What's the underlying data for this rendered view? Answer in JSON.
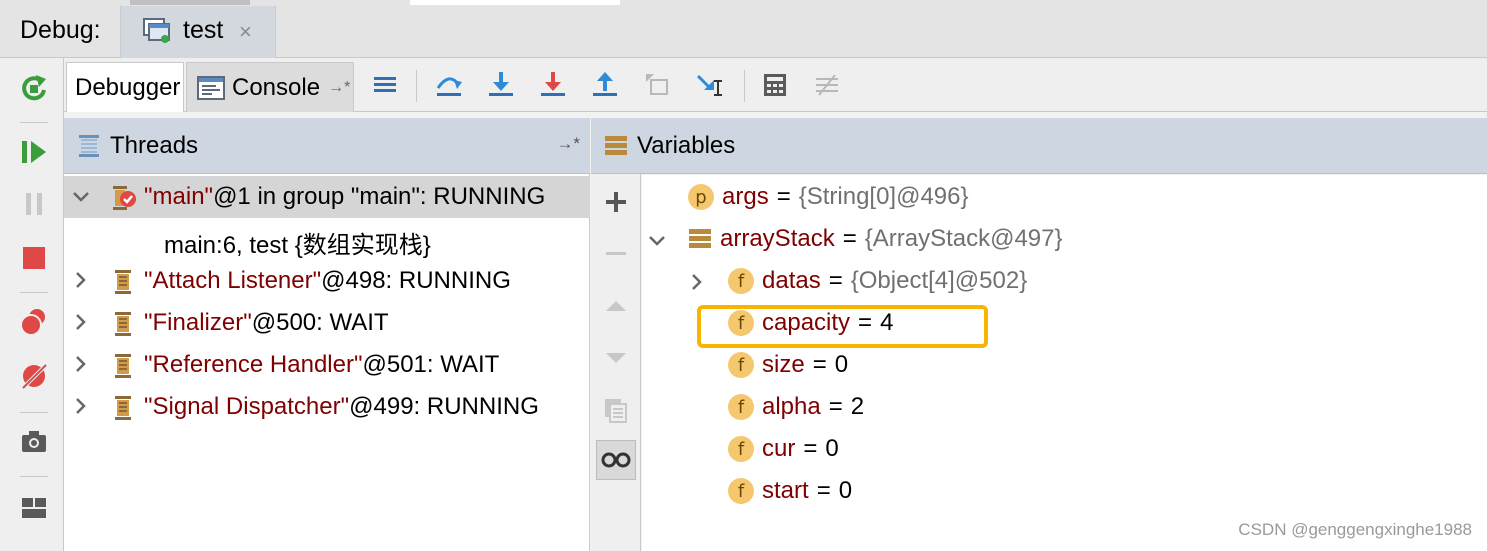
{
  "debug_window": {
    "label": "Debug:",
    "tab_title": "test",
    "tab_close_glyph": "×"
  },
  "toolbar": {
    "debugger_tab": "Debugger",
    "console_tab": "Console",
    "console_pin_glyph": "→*",
    "icons": [
      "show-execution-point-icon",
      "step-over-icon",
      "step-into-icon",
      "force-step-into-icon",
      "step-out-icon",
      "drop-frame-icon",
      "run-to-cursor-icon",
      "evaluate-expression-icon",
      "trace-icon"
    ]
  },
  "left_actions": [
    "rerun-icon",
    "resume-icon",
    "pause-icon",
    "stop-icon",
    "view-breakpoints-icon",
    "mute-breakpoints-icon",
    "camera-icon",
    "layout-icon"
  ],
  "threads": {
    "title": "Threads",
    "pin_glyph": "→*",
    "items": [
      {
        "quoted": "\"main\"",
        "rest": "@1 in group \"main\": RUNNING",
        "expanded": true,
        "selected": true
      },
      {
        "quoted": "\"Attach Listener\"",
        "rest": "@498: RUNNING",
        "expanded": false
      },
      {
        "quoted": "\"Finalizer\"",
        "rest": "@500: WAIT",
        "expanded": false
      },
      {
        "quoted": "\"Reference Handler\"",
        "rest": "@501: WAIT",
        "expanded": false
      },
      {
        "quoted": "\"Signal Dispatcher\"",
        "rest": "@499: RUNNING",
        "expanded": false
      }
    ],
    "frame": "main:6, test {数组实现栈}"
  },
  "variables": {
    "title": "Variables",
    "side_buttons": [
      "add-icon",
      "remove-icon",
      "move-up-icon",
      "move-down-icon",
      "copy-icon",
      "watches-icon"
    ],
    "rows": [
      {
        "badge": "p",
        "name": "args",
        "eq": "=",
        "value": "{String[0]@496}",
        "object": true
      },
      {
        "badge": "",
        "name": "arrayStack",
        "eq": "=",
        "value": "{ArrayStack@497}",
        "object": true
      },
      {
        "badge": "f",
        "name": "datas",
        "eq": "=",
        "value": "{Object[4]@502}",
        "object": true
      },
      {
        "badge": "f",
        "name": "capacity",
        "eq": "=",
        "value": "4",
        "object": false
      },
      {
        "badge": "f",
        "name": "size",
        "eq": "=",
        "value": "0",
        "object": false
      },
      {
        "badge": "f",
        "name": "alpha",
        "eq": "=",
        "value": "2",
        "object": false
      },
      {
        "badge": "f",
        "name": "cur",
        "eq": "=",
        "value": "0",
        "object": false
      },
      {
        "badge": "f",
        "name": "start",
        "eq": "=",
        "value": "0",
        "object": false
      }
    ]
  },
  "watermark": "CSDN @genggengxinghe1988",
  "colors": {
    "header_bg": "#cdd6e1",
    "name_red": "#7f0000",
    "badge": "#f5c86f",
    "highlight": "#f7b500",
    "selected_row": "#d5d5d5"
  }
}
